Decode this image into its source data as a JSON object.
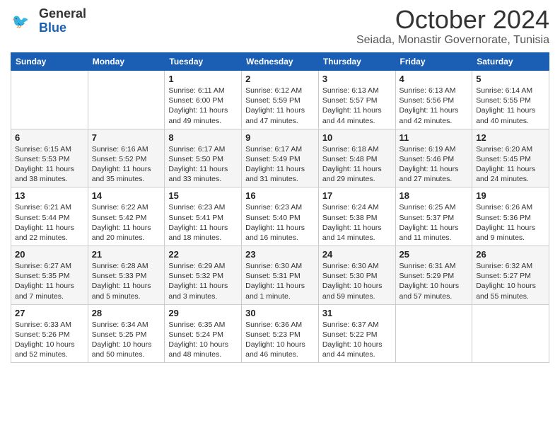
{
  "logo": {
    "line1": "General",
    "line2": "Blue"
  },
  "header": {
    "month": "October 2024",
    "location": "Seiada, Monastir Governorate, Tunisia"
  },
  "weekdays": [
    "Sunday",
    "Monday",
    "Tuesday",
    "Wednesday",
    "Thursday",
    "Friday",
    "Saturday"
  ],
  "weeks": [
    [
      {
        "day": null,
        "sunrise": null,
        "sunset": null,
        "daylight": null
      },
      {
        "day": null,
        "sunrise": null,
        "sunset": null,
        "daylight": null
      },
      {
        "day": "1",
        "sunrise": "Sunrise: 6:11 AM",
        "sunset": "Sunset: 6:00 PM",
        "daylight": "Daylight: 11 hours and 49 minutes."
      },
      {
        "day": "2",
        "sunrise": "Sunrise: 6:12 AM",
        "sunset": "Sunset: 5:59 PM",
        "daylight": "Daylight: 11 hours and 47 minutes."
      },
      {
        "day": "3",
        "sunrise": "Sunrise: 6:13 AM",
        "sunset": "Sunset: 5:57 PM",
        "daylight": "Daylight: 11 hours and 44 minutes."
      },
      {
        "day": "4",
        "sunrise": "Sunrise: 6:13 AM",
        "sunset": "Sunset: 5:56 PM",
        "daylight": "Daylight: 11 hours and 42 minutes."
      },
      {
        "day": "5",
        "sunrise": "Sunrise: 6:14 AM",
        "sunset": "Sunset: 5:55 PM",
        "daylight": "Daylight: 11 hours and 40 minutes."
      }
    ],
    [
      {
        "day": "6",
        "sunrise": "Sunrise: 6:15 AM",
        "sunset": "Sunset: 5:53 PM",
        "daylight": "Daylight: 11 hours and 38 minutes."
      },
      {
        "day": "7",
        "sunrise": "Sunrise: 6:16 AM",
        "sunset": "Sunset: 5:52 PM",
        "daylight": "Daylight: 11 hours and 35 minutes."
      },
      {
        "day": "8",
        "sunrise": "Sunrise: 6:17 AM",
        "sunset": "Sunset: 5:50 PM",
        "daylight": "Daylight: 11 hours and 33 minutes."
      },
      {
        "day": "9",
        "sunrise": "Sunrise: 6:17 AM",
        "sunset": "Sunset: 5:49 PM",
        "daylight": "Daylight: 11 hours and 31 minutes."
      },
      {
        "day": "10",
        "sunrise": "Sunrise: 6:18 AM",
        "sunset": "Sunset: 5:48 PM",
        "daylight": "Daylight: 11 hours and 29 minutes."
      },
      {
        "day": "11",
        "sunrise": "Sunrise: 6:19 AM",
        "sunset": "Sunset: 5:46 PM",
        "daylight": "Daylight: 11 hours and 27 minutes."
      },
      {
        "day": "12",
        "sunrise": "Sunrise: 6:20 AM",
        "sunset": "Sunset: 5:45 PM",
        "daylight": "Daylight: 11 hours and 24 minutes."
      }
    ],
    [
      {
        "day": "13",
        "sunrise": "Sunrise: 6:21 AM",
        "sunset": "Sunset: 5:44 PM",
        "daylight": "Daylight: 11 hours and 22 minutes."
      },
      {
        "day": "14",
        "sunrise": "Sunrise: 6:22 AM",
        "sunset": "Sunset: 5:42 PM",
        "daylight": "Daylight: 11 hours and 20 minutes."
      },
      {
        "day": "15",
        "sunrise": "Sunrise: 6:23 AM",
        "sunset": "Sunset: 5:41 PM",
        "daylight": "Daylight: 11 hours and 18 minutes."
      },
      {
        "day": "16",
        "sunrise": "Sunrise: 6:23 AM",
        "sunset": "Sunset: 5:40 PM",
        "daylight": "Daylight: 11 hours and 16 minutes."
      },
      {
        "day": "17",
        "sunrise": "Sunrise: 6:24 AM",
        "sunset": "Sunset: 5:38 PM",
        "daylight": "Daylight: 11 hours and 14 minutes."
      },
      {
        "day": "18",
        "sunrise": "Sunrise: 6:25 AM",
        "sunset": "Sunset: 5:37 PM",
        "daylight": "Daylight: 11 hours and 11 minutes."
      },
      {
        "day": "19",
        "sunrise": "Sunrise: 6:26 AM",
        "sunset": "Sunset: 5:36 PM",
        "daylight": "Daylight: 11 hours and 9 minutes."
      }
    ],
    [
      {
        "day": "20",
        "sunrise": "Sunrise: 6:27 AM",
        "sunset": "Sunset: 5:35 PM",
        "daylight": "Daylight: 11 hours and 7 minutes."
      },
      {
        "day": "21",
        "sunrise": "Sunrise: 6:28 AM",
        "sunset": "Sunset: 5:33 PM",
        "daylight": "Daylight: 11 hours and 5 minutes."
      },
      {
        "day": "22",
        "sunrise": "Sunrise: 6:29 AM",
        "sunset": "Sunset: 5:32 PM",
        "daylight": "Daylight: 11 hours and 3 minutes."
      },
      {
        "day": "23",
        "sunrise": "Sunrise: 6:30 AM",
        "sunset": "Sunset: 5:31 PM",
        "daylight": "Daylight: 11 hours and 1 minute."
      },
      {
        "day": "24",
        "sunrise": "Sunrise: 6:30 AM",
        "sunset": "Sunset: 5:30 PM",
        "daylight": "Daylight: 10 hours and 59 minutes."
      },
      {
        "day": "25",
        "sunrise": "Sunrise: 6:31 AM",
        "sunset": "Sunset: 5:29 PM",
        "daylight": "Daylight: 10 hours and 57 minutes."
      },
      {
        "day": "26",
        "sunrise": "Sunrise: 6:32 AM",
        "sunset": "Sunset: 5:27 PM",
        "daylight": "Daylight: 10 hours and 55 minutes."
      }
    ],
    [
      {
        "day": "27",
        "sunrise": "Sunrise: 6:33 AM",
        "sunset": "Sunset: 5:26 PM",
        "daylight": "Daylight: 10 hours and 52 minutes."
      },
      {
        "day": "28",
        "sunrise": "Sunrise: 6:34 AM",
        "sunset": "Sunset: 5:25 PM",
        "daylight": "Daylight: 10 hours and 50 minutes."
      },
      {
        "day": "29",
        "sunrise": "Sunrise: 6:35 AM",
        "sunset": "Sunset: 5:24 PM",
        "daylight": "Daylight: 10 hours and 48 minutes."
      },
      {
        "day": "30",
        "sunrise": "Sunrise: 6:36 AM",
        "sunset": "Sunset: 5:23 PM",
        "daylight": "Daylight: 10 hours and 46 minutes."
      },
      {
        "day": "31",
        "sunrise": "Sunrise: 6:37 AM",
        "sunset": "Sunset: 5:22 PM",
        "daylight": "Daylight: 10 hours and 44 minutes."
      },
      {
        "day": null,
        "sunrise": null,
        "sunset": null,
        "daylight": null
      },
      {
        "day": null,
        "sunrise": null,
        "sunset": null,
        "daylight": null
      }
    ]
  ]
}
